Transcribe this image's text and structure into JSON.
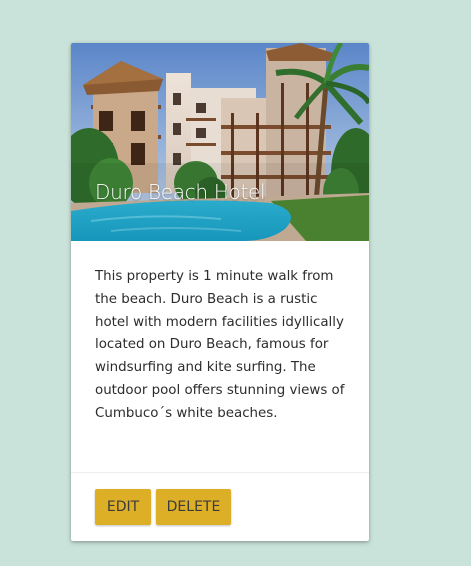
{
  "card": {
    "title": "Duro Beach Hotel",
    "description": "This property is 1 minute walk from the beach. Duro Beach is a rustic hotel with modern facilities idyllically located on Duro Beach, famous for windsurfing and kite surfing. The outdoor pool offers stunning views of Cumbuco´s white beaches.",
    "actions": {
      "edit_label": "EDIT",
      "delete_label": "DELETE"
    }
  },
  "colors": {
    "page_background": "#c9e3da",
    "card_background": "#ffffff",
    "button_background": "#ddaf26",
    "button_text": "#3b3b3b"
  }
}
